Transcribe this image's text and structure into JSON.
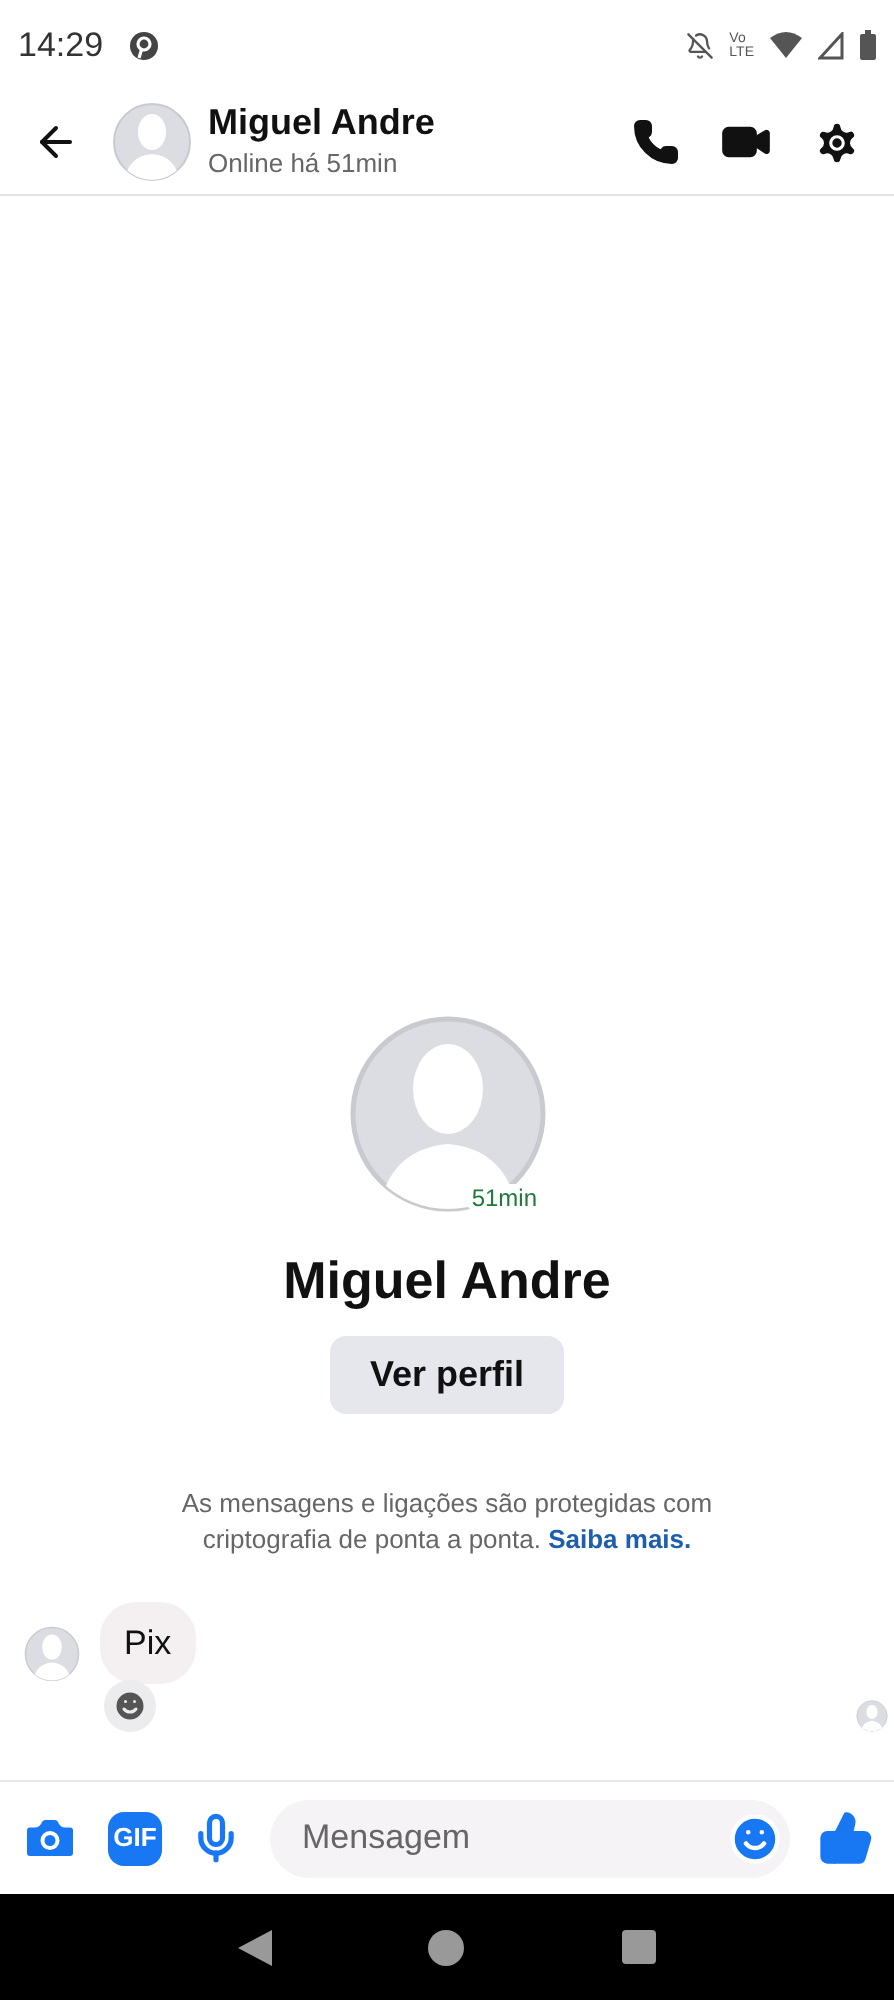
{
  "status_bar": {
    "time": "14:29",
    "network_label": [
      "Vo",
      "LTE"
    ]
  },
  "header": {
    "name": "Miguel Andre",
    "status": "Online há 51min"
  },
  "profile": {
    "name": "Miguel Andre",
    "last_active": "51min",
    "button": "Ver perfil"
  },
  "encryption_notice": {
    "text": "As mensagens e ligações são protegidas com criptografia de ponta a ponta.",
    "link": "Saiba mais."
  },
  "messages": [
    {
      "text": "Pix",
      "incoming": true
    }
  ],
  "composer": {
    "gif_label": "GIF",
    "placeholder": "Mensagem"
  }
}
